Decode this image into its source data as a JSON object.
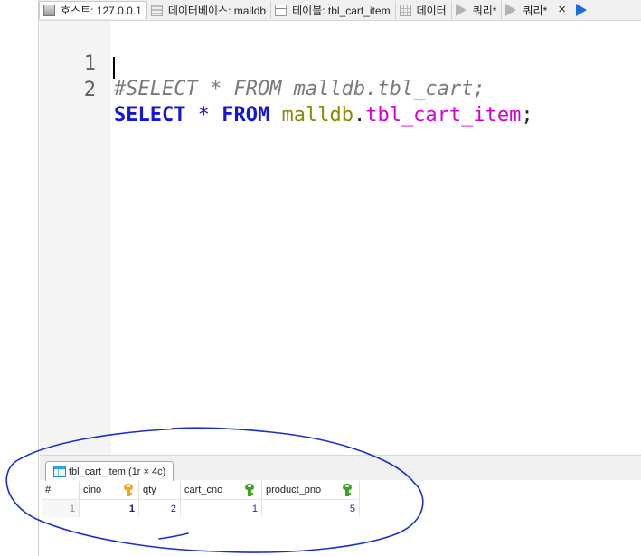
{
  "tabs": [
    {
      "label": "호스트: 127.0.0.1",
      "icon": "server-icon"
    },
    {
      "label": "데이터베이스: malldb",
      "icon": "database-icon"
    },
    {
      "label": "테이블: tbl_cart_item",
      "icon": "table-icon"
    },
    {
      "label": "데이터",
      "icon": "grid-icon"
    },
    {
      "label": "쿼리*",
      "icon": "play-icon"
    },
    {
      "label": "쿼리*",
      "icon": "play-icon"
    }
  ],
  "tab_close": "×",
  "editor": {
    "lines": [
      {
        "num": "1",
        "comment": "#SELECT * FROM malldb.tbl_cart;"
      },
      {
        "num": "2",
        "kw_select": "SELECT",
        "star": "*",
        "kw_from": "FROM",
        "db": "malldb",
        "dot": ".",
        "table": "tbl_cart_item",
        "semi": ";"
      }
    ]
  },
  "results": {
    "tab_label": "tbl_cart_item (1r × 4c)",
    "columns": [
      {
        "name": "#",
        "key": ""
      },
      {
        "name": "cino",
        "key": "primary-key-icon"
      },
      {
        "name": "qty",
        "key": ""
      },
      {
        "name": "cart_cno",
        "key": "foreign-key-icon"
      },
      {
        "name": "product_pno",
        "key": "foreign-key-icon"
      }
    ],
    "rows": [
      [
        "1",
        "1",
        "2",
        "1",
        "5"
      ]
    ]
  },
  "colors": {
    "keyword": "#1515d8",
    "comment": "#7a7a7a",
    "database": "#8a8a00",
    "table": "#d400d4",
    "annotation": "#1a2fc8",
    "primary_key": "#f2a81d",
    "foreign_key": "#3aa51d"
  }
}
